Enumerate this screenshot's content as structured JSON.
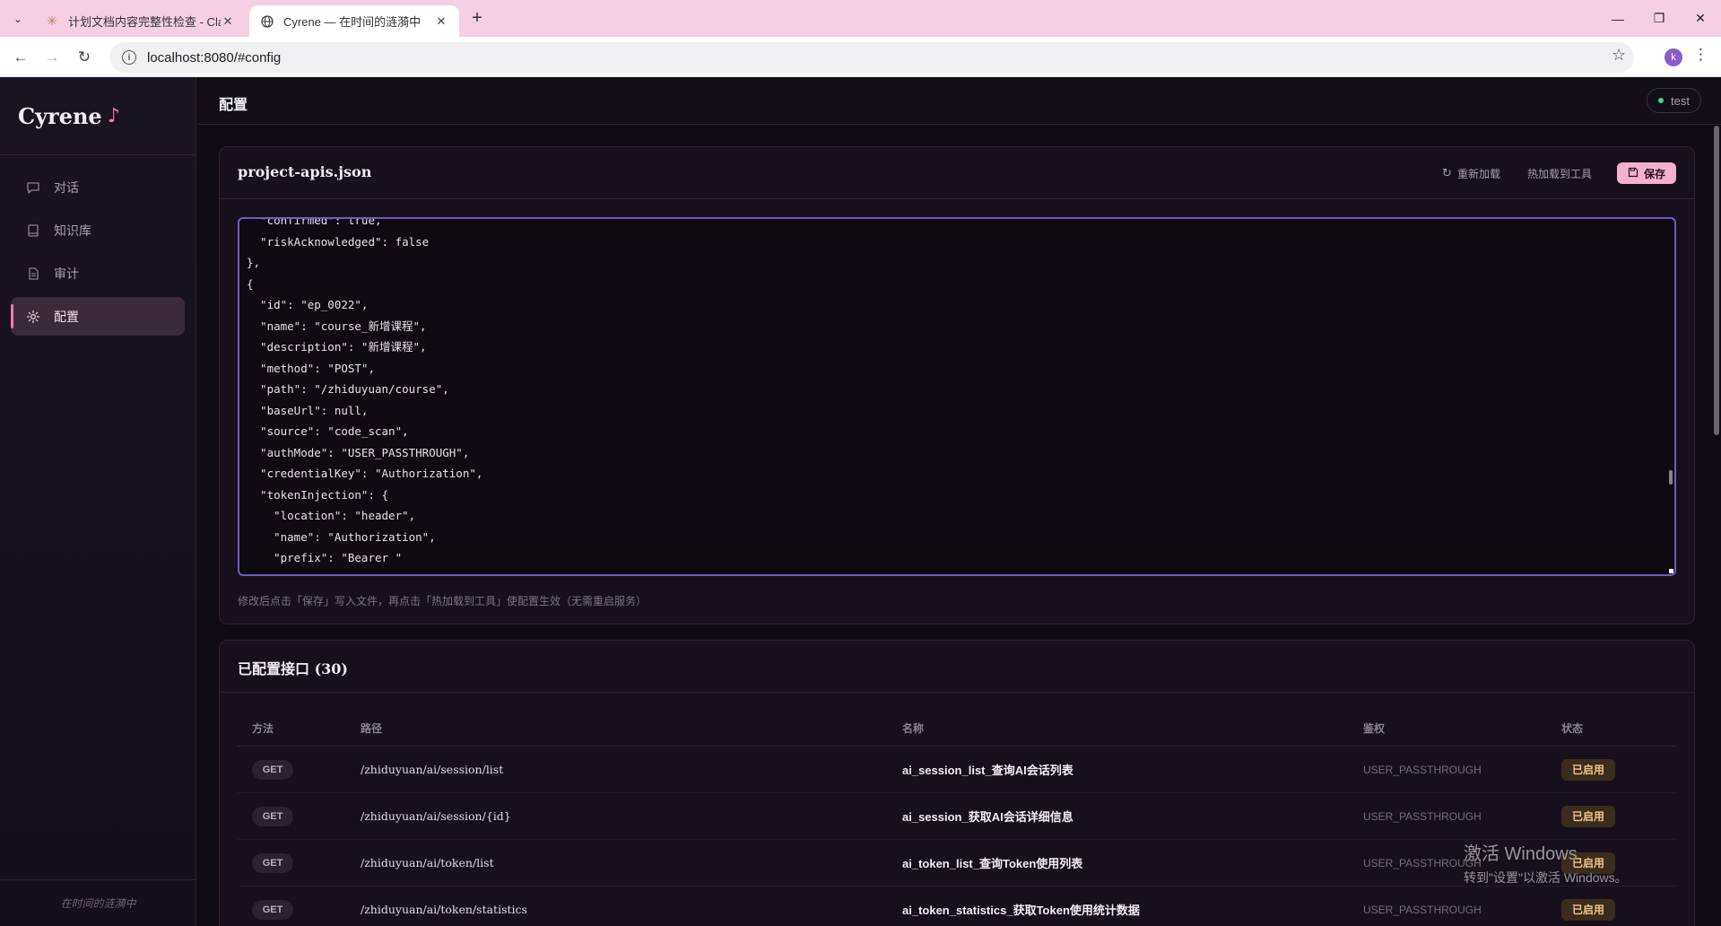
{
  "browser": {
    "tabs": [
      {
        "title": "计划文档内容完整性检查 - Cla",
        "icon": "claude-icon"
      },
      {
        "title": "Cyrene — 在时间的涟漪中",
        "icon": "globe-icon"
      }
    ],
    "url": "localhost:8080/#config",
    "profile_initial": "k"
  },
  "sidebar": {
    "brand": "Cyrene",
    "brand_mark": "♪",
    "items": [
      {
        "label": "对话",
        "icon": "chat-icon"
      },
      {
        "label": "知识库",
        "icon": "book-icon"
      },
      {
        "label": "审计",
        "icon": "document-icon"
      },
      {
        "label": "配置",
        "icon": "gear-icon",
        "active": true
      }
    ],
    "footer": "在时间的涟漪中"
  },
  "topbar": {
    "title": "配置",
    "env": "test",
    "env_status_color": "#49d18b"
  },
  "config_card": {
    "title": "project-apis.json",
    "reload_label": "重新加载",
    "hotload_label": "热加载到工具",
    "save_label": "保存",
    "editor_content": "  \"confirmed\": true,\n  \"riskAcknowledged\": false\n},\n{\n  \"id\": \"ep_0022\",\n  \"name\": \"course_新增课程\",\n  \"description\": \"新增课程\",\n  \"method\": \"POST\",\n  \"path\": \"/zhiduyuan/course\",\n  \"baseUrl\": null,\n  \"source\": \"code_scan\",\n  \"authMode\": \"USER_PASSTHROUGH\",\n  \"credentialKey\": \"Authorization\",\n  \"tokenInjection\": {\n    \"location\": \"header\",\n    \"name\": \"Authorization\",\n    \"prefix\": \"Bearer \"\n  }",
    "hint": "修改后点击「保存」写入文件，再点击「热加载到工具」使配置生效（无需重启服务）"
  },
  "endpoints_card": {
    "title": "已配置接口 (30)",
    "columns": [
      "方法",
      "路径",
      "名称",
      "鉴权",
      "状态"
    ],
    "rows": [
      {
        "method": "GET",
        "path": "/zhiduyuan/ai/session/list",
        "name": "ai_session_list_查询AI会话列表",
        "auth": "USER_PASSTHROUGH",
        "status": "已启用"
      },
      {
        "method": "GET",
        "path": "/zhiduyuan/ai/session/{id}",
        "name": "ai_session_获取AI会话详细信息",
        "auth": "USER_PASSTHROUGH",
        "status": "已启用"
      },
      {
        "method": "GET",
        "path": "/zhiduyuan/ai/token/list",
        "name": "ai_token_list_查询Token使用列表",
        "auth": "USER_PASSTHROUGH",
        "status": "已启用"
      },
      {
        "method": "GET",
        "path": "/zhiduyuan/ai/token/statistics",
        "name": "ai_token_statistics_获取Token使用统计数据",
        "auth": "USER_PASSTHROUGH",
        "status": "已启用"
      }
    ]
  },
  "watermark": {
    "line1": "激活 Windows",
    "line2": "转到\"设置\"以激活 Windows。"
  }
}
